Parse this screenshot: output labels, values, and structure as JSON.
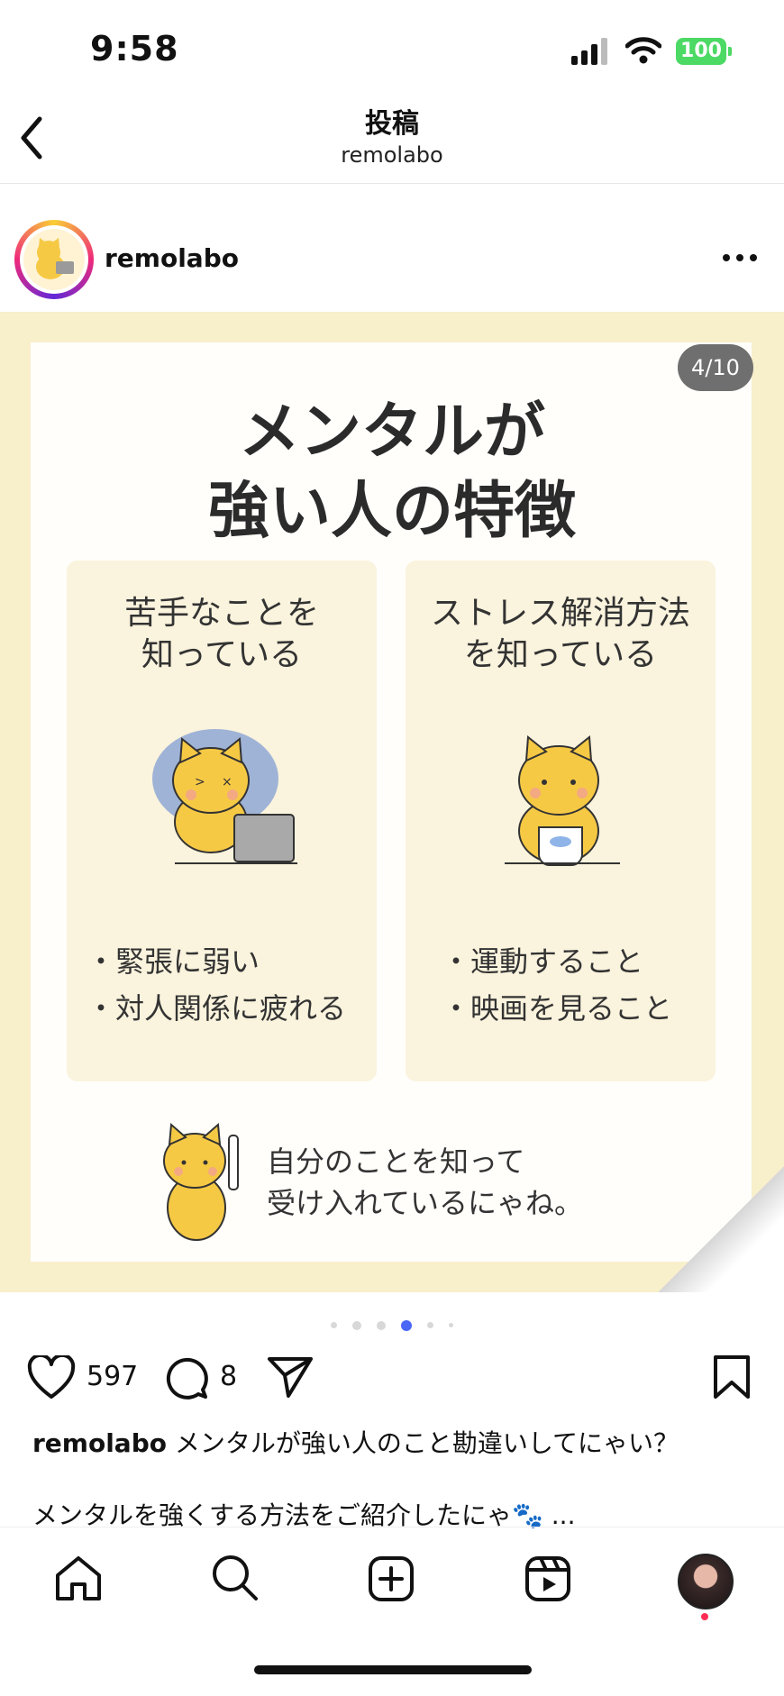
{
  "status_bar": {
    "time": "9:58",
    "battery": "100"
  },
  "header": {
    "title": "投稿",
    "subtitle": "remolabo"
  },
  "post": {
    "username": "remolabo",
    "image": {
      "counter": "4/10",
      "title_line1": "メンタルが",
      "title_line2": "強い人の特徴",
      "left_panel": {
        "title": "苦手なことを\n知っている",
        "bullets": [
          "・緊張に弱い",
          "・対人関係に疲れる"
        ]
      },
      "right_panel": {
        "title": "ストレス解消方法\nを知っている",
        "bullets": [
          "・運動すること",
          "・映画を見ること"
        ]
      },
      "bottom_text": "自分のことを知って\n受け入れているにゃね。"
    },
    "carousel": {
      "total_dots": 6,
      "active_index": 3
    },
    "likes": "597",
    "comments": "8",
    "caption_user": "remolabo",
    "caption_text": "メンタルが強い人のこと勘違いしてにゃい？",
    "caption_line2": "メンタルを強くする方法をご紹介したにゃ🐾 ..."
  },
  "colors": {
    "accent": "#4a68f5",
    "battery": "#4cd964",
    "image_bg": "#f8efcb",
    "panel_bg": "#faf3dd",
    "cat": "#f6c945"
  },
  "icons": [
    "back-icon",
    "signal-icon",
    "wifi-icon",
    "more-icon",
    "heart-icon",
    "comment-icon",
    "share-icon",
    "bookmark-icon",
    "home-icon",
    "search-icon",
    "create-icon",
    "reels-icon"
  ]
}
